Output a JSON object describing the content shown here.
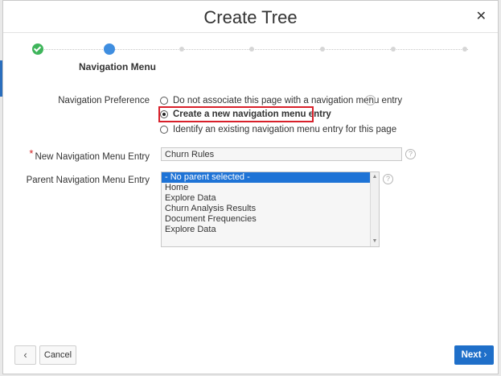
{
  "dialog": {
    "title": "Create Tree",
    "close_icon": "close-icon"
  },
  "wizard": {
    "current_step_label": "Navigation Menu",
    "steps": [
      {
        "state": "done"
      },
      {
        "state": "current"
      },
      {
        "state": "future"
      },
      {
        "state": "future"
      },
      {
        "state": "future"
      },
      {
        "state": "future"
      },
      {
        "state": "future"
      }
    ]
  },
  "navigation_preference": {
    "label": "Navigation Preference",
    "options": [
      {
        "label": "Do not associate this page with a navigation menu entry",
        "checked": false
      },
      {
        "label": "Create a new navigation menu entry",
        "checked": true
      },
      {
        "label": "Identify an existing navigation menu entry for this page",
        "checked": false
      }
    ],
    "highlight_color": "#d8202a"
  },
  "new_entry": {
    "label": "New Navigation Menu Entry",
    "required_marker": "*",
    "value": "Churn Rules"
  },
  "parent_entry": {
    "label": "Parent Navigation Menu Entry",
    "options": [
      {
        "label": "- No parent selected -",
        "selected": true
      },
      {
        "label": "Home",
        "selected": false
      },
      {
        "label": "Explore Data",
        "selected": false
      },
      {
        "label": "Churn Analysis Results",
        "selected": false
      },
      {
        "label": "Document Frequencies",
        "selected": false
      },
      {
        "label": "Explore Data",
        "selected": false
      }
    ]
  },
  "footer": {
    "back_icon": "chevron-left-icon",
    "cancel_label": "Cancel",
    "next_label": "Next",
    "accent_color": "#1f6fc9"
  },
  "help_glyph": "?",
  "colors": {
    "step_done": "#3fb55b",
    "step_current": "#3f8ee0",
    "selected_option": "#1e73d6"
  }
}
